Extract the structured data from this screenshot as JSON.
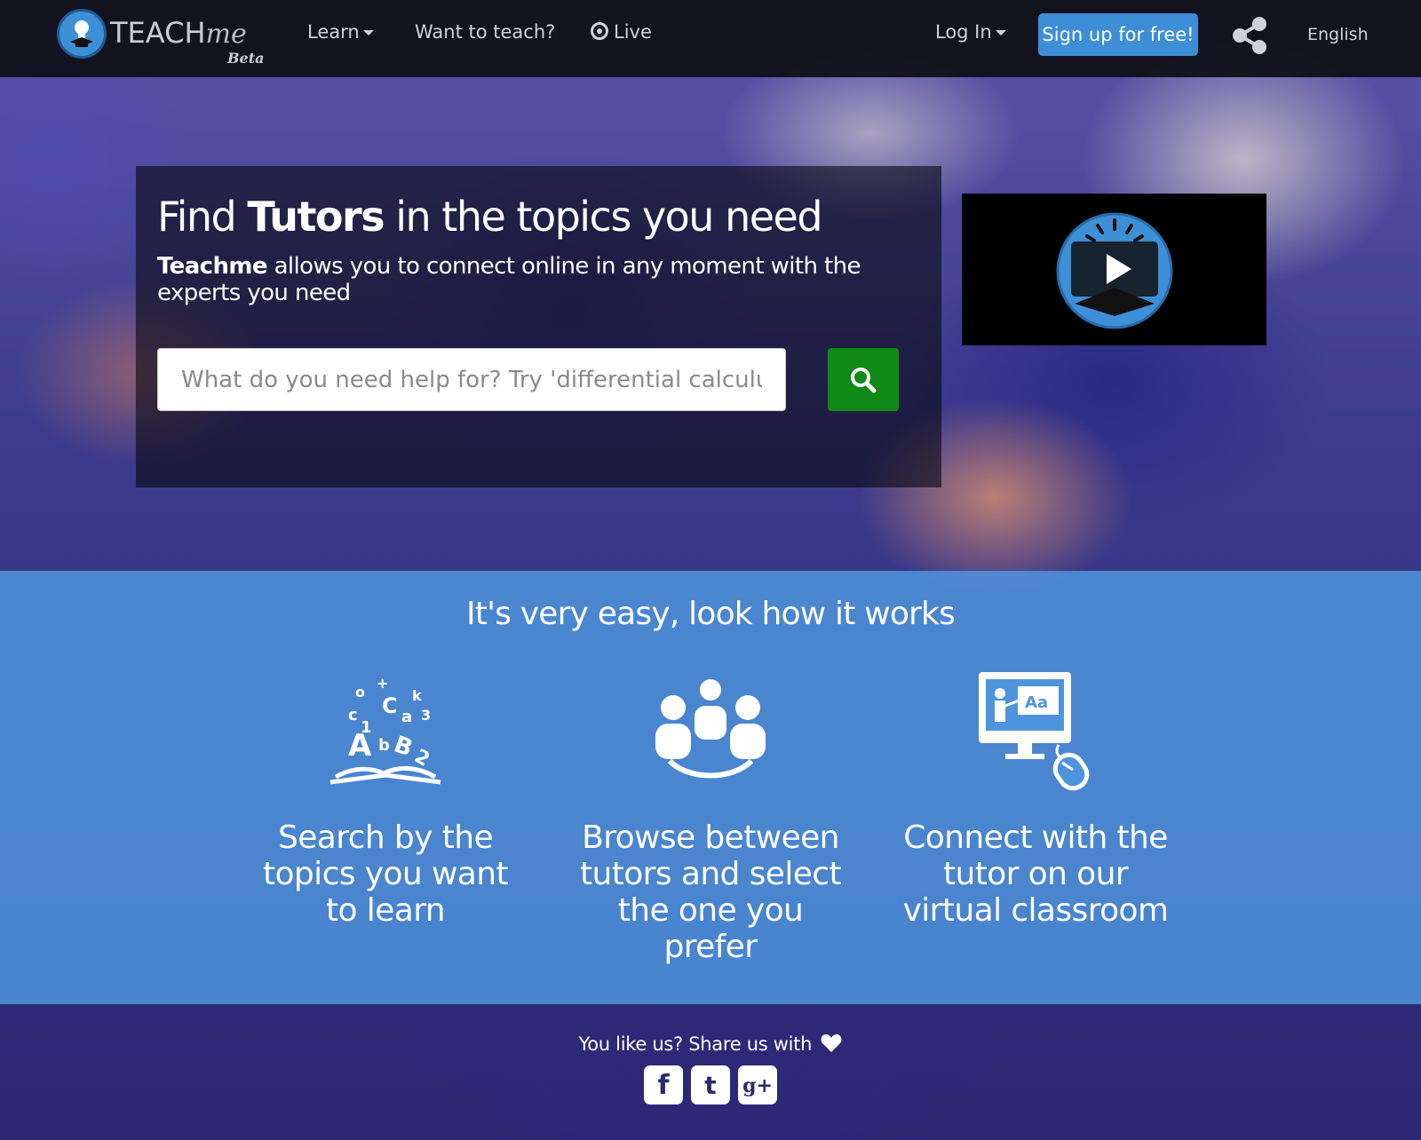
{
  "nav": {
    "logo_text": "TEACH",
    "logo_me": "me",
    "logo_beta": "Beta",
    "learn_label": "Learn",
    "teach_label": "Want to teach?",
    "live_label": "Live",
    "login_label": "Log In",
    "signup_label": "Sign up for free!",
    "language_label": "English"
  },
  "hero": {
    "title_pre": "Find ",
    "title_bold": "Tutors",
    "title_post": " in the topics you need",
    "subtitle_bold": "Teachme",
    "subtitle_rest": " allows you to connect online in any moment with the experts you need",
    "search_placeholder": "What do you need help for? Try 'differential calculus'"
  },
  "how_it_works": {
    "title": "It's very easy, look how it works",
    "steps": [
      {
        "icon": "alphabet-book-icon",
        "text": "Search by the topics you want to learn"
      },
      {
        "icon": "group-people-icon",
        "text": "Browse between tutors and select the one you prefer"
      },
      {
        "icon": "virtual-classroom-icon",
        "text": "Connect with the tutor on our virtual classroom"
      }
    ]
  },
  "share": {
    "label": "You like us? Share us with",
    "networks": [
      {
        "icon": "facebook-icon",
        "glyph": "f"
      },
      {
        "icon": "twitter-icon",
        "glyph": "t"
      },
      {
        "icon": "google-plus-icon",
        "glyph": "g+"
      }
    ]
  },
  "colors": {
    "accent_blue": "#3d8ed6",
    "search_green": "#0f8a17",
    "how_band": "#4e94dc",
    "nav_bg": "#0e0e16"
  }
}
